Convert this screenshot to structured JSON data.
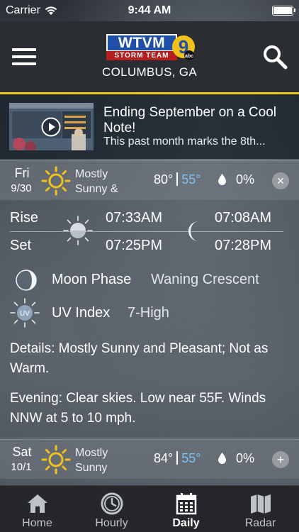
{
  "status_bar": {
    "carrier": "Carrier",
    "time": "9:44 AM"
  },
  "header": {
    "logo_call_letters": "WTVM",
    "logo_tagline": "STORM TEAM",
    "logo_channel": "9",
    "logo_network": "abc",
    "location": "COLUMBUS, GA"
  },
  "news": {
    "title": "Ending September on a Cool Note!",
    "snippet": "This past month marks the 8th..."
  },
  "days": [
    {
      "day": "Fri",
      "date": "9/30",
      "condition": "Mostly Sunny &",
      "high": "80°",
      "low": "55°",
      "precip": "0%",
      "toggle": "×",
      "expanded": true
    },
    {
      "day": "Sat",
      "date": "10/1",
      "condition": "Mostly Sunny",
      "high": "84°",
      "low": "55°",
      "precip": "0%",
      "toggle": "+",
      "expanded": false
    }
  ],
  "details": {
    "rise_label": "Rise",
    "set_label": "Set",
    "sunrise": "07:33AM",
    "sunset": "07:25PM",
    "moonrise": "07:08AM",
    "moonset": "07:28PM",
    "moon_phase_label": "Moon Phase",
    "moon_phase_value": "Waning Crescent",
    "uv_label": "UV Index",
    "uv_value": "7-High",
    "uv_icon_text": "UV",
    "details_text": "Details: Mostly Sunny and Pleasant; Not as Warm.",
    "evening_text": "Evening: Clear skies. Low near 55F. Winds NNW at 5 to 10 mph."
  },
  "tabs": [
    {
      "label": "Home",
      "icon": "home-icon",
      "active": false
    },
    {
      "label": "Hourly",
      "icon": "clock-icon",
      "active": false
    },
    {
      "label": "Daily",
      "icon": "calendar-icon",
      "active": true
    },
    {
      "label": "Radar",
      "icon": "map-icon",
      "active": false
    }
  ],
  "colors": {
    "accent": "#f0c419",
    "low_temp": "#7cc3f0",
    "sun": "#f2c21b"
  }
}
